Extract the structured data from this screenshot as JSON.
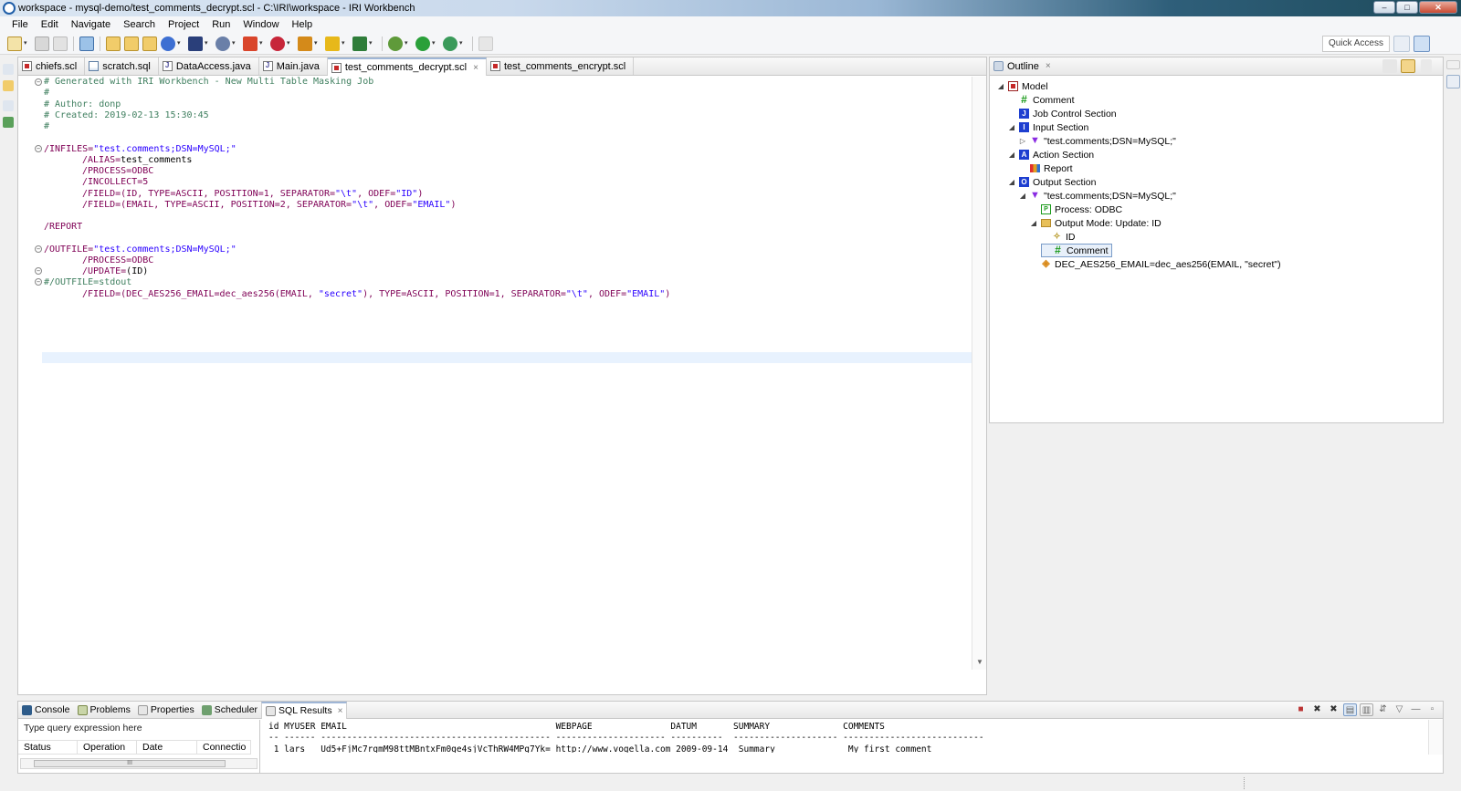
{
  "window": {
    "title": "workspace - mysql-demo/test_comments_decrypt.scl - C:\\IRI\\workspace - IRI Workbench"
  },
  "menu": [
    "File",
    "Edit",
    "Navigate",
    "Search",
    "Project",
    "Run",
    "Window",
    "Help"
  ],
  "toolbar": {
    "quick_access": "Quick Access"
  },
  "editor": {
    "tabs": [
      {
        "label": "chiefs.scl",
        "icon": "scl-file-icon"
      },
      {
        "label": "scratch.sql",
        "icon": "sql-file-icon"
      },
      {
        "label": "DataAccess.java",
        "icon": "java-file-icon"
      },
      {
        "label": "Main.java",
        "icon": "java-file-icon"
      },
      {
        "label": "test_comments_decrypt.scl",
        "icon": "scl-file-icon",
        "active": true,
        "close": "×"
      },
      {
        "label": "test_comments_encrypt.scl",
        "icon": "scl-file-icon"
      }
    ],
    "lines": {
      "l1": "# Generated with IRI Workbench - New Multi Table Masking Job",
      "l2": "#",
      "l3": "# Author: donp",
      "l4": "# Created: 2019-02-13 15:30:45",
      "l5": "#",
      "l6a": "/INFILES=",
      "l6b": "\"test.comments;DSN=MySQL;\"",
      "l7a": "/ALIAS=",
      "l7b": "test_comments",
      "l8a": "/PROCESS=",
      "l8b": "ODBC",
      "l9a": "/INCOLLECT=",
      "l9b": "5",
      "l10a": "/FIELD=",
      "l10b": "(ID, ",
      "l10c": "TYPE=",
      "l10d": "ASCII, ",
      "l10e": "POSITION=",
      "l10f": "1, ",
      "l10g": "SEPARATOR=",
      "l10h": "\"\\t\"",
      "l10i": ", ",
      "l10j": "ODEF=",
      "l10k": "\"ID\"",
      "l10l": ")",
      "l11a": "/FIELD=",
      "l11b": "(EMAIL, ",
      "l11c": "TYPE=",
      "l11d": "ASCII, ",
      "l11e": "POSITION=",
      "l11f": "2, ",
      "l11g": "SEPARATOR=",
      "l11h": "\"\\t\"",
      "l11i": ", ",
      "l11j": "ODEF=",
      "l11k": "\"EMAIL\"",
      "l11l": ")",
      "l12": "/REPORT",
      "l13a": "/OUTFILE=",
      "l13b": "\"test.comments;DSN=MySQL;\"",
      "l14a": "/PROCESS=",
      "l14b": "ODBC",
      "l15a": "/UPDATE=",
      "l15b": "(ID)",
      "l16": "#/OUTFILE=stdout",
      "l17a": "/FIELD=",
      "l17b": "(DEC_AES256_EMAIL=dec_aes256(EMAIL, ",
      "l17c": "\"secret\"",
      "l17d": "), ",
      "l17e": "TYPE=",
      "l17f": "ASCII, ",
      "l17g": "POSITION=",
      "l17h": "1, ",
      "l17i": "SEPARATOR=",
      "l17j": "\"\\t\"",
      "l17k": ", ",
      "l17l": "ODEF=",
      "l17m": "\"EMAIL\"",
      "l17n": ")"
    }
  },
  "outline": {
    "title": "Outline",
    "close": "×",
    "nodes": {
      "model": "Model",
      "comment1": "Comment",
      "job_control": "Job Control Section",
      "input": "Input Section",
      "input_src": "\"test.comments;DSN=MySQL;\"",
      "action": "Action Section",
      "report": "Report",
      "output": "Output Section",
      "output_tgt": "\"test.comments;DSN=MySQL;\"",
      "process": "Process: ODBC",
      "output_mode": "Output Mode: Update: ID",
      "id": "ID",
      "comment2": "Comment",
      "dec": "DEC_AES256_EMAIL=dec_aes256(EMAIL, \"secret\")"
    }
  },
  "bottom": {
    "tabs": [
      {
        "label": "Console"
      },
      {
        "label": "Problems"
      },
      {
        "label": "Properties"
      },
      {
        "label": "Scheduler"
      },
      {
        "label": "SQL Results",
        "active": true,
        "close": "×"
      }
    ],
    "query_placeholder": "Type query expression here",
    "history_cols": [
      "Status",
      "Operation",
      "Date",
      "Connectio"
    ],
    "scroll_thumb": "III",
    "results": {
      "header": "id MYUSER EMAIL                                        WEBPAGE               DATUM       SUMMARY              COMMENTS",
      "rule": "-- ------ -------------------------------------------- --------------------- ----------  -------------------- ---------------------------",
      "row1": " 1 lars   Ud5+FjMc7rgmM98ttMBntxFm0qe4sjVcThRW4MPg7Yk= http://www.vogella.com 2009-09-14  Summary              My first comment"
    }
  }
}
